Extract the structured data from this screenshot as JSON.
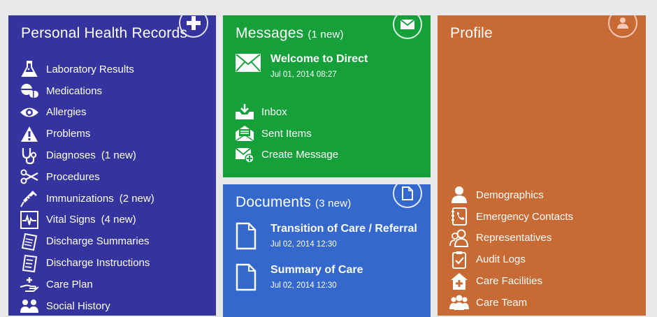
{
  "phr": {
    "title": "Personal Health Records",
    "items": [
      {
        "label": "Laboratory Results",
        "new": ""
      },
      {
        "label": "Medications",
        "new": ""
      },
      {
        "label": "Allergies",
        "new": ""
      },
      {
        "label": "Problems",
        "new": ""
      },
      {
        "label": "Diagnoses",
        "new": "(1 new)"
      },
      {
        "label": "Procedures",
        "new": ""
      },
      {
        "label": "Immunizations",
        "new": "(2 new)"
      },
      {
        "label": "Vital Signs",
        "new": "(4 new)"
      },
      {
        "label": "Discharge Summaries",
        "new": ""
      },
      {
        "label": "Discharge Instructions",
        "new": ""
      },
      {
        "label": "Care Plan",
        "new": ""
      },
      {
        "label": "Social History",
        "new": ""
      }
    ]
  },
  "messages": {
    "title": "Messages",
    "count": "(1 new)",
    "latest": {
      "subject": "Welcome to Direct",
      "date": "Jul 01, 2014 08:27"
    },
    "actions": [
      {
        "label": "Inbox"
      },
      {
        "label": "Sent Items"
      },
      {
        "label": "Create Message"
      }
    ]
  },
  "documents": {
    "title": "Documents",
    "count": "(3 new)",
    "items": [
      {
        "title": "Transition of Care / Referral",
        "date": "Jul 02, 2014 12:30"
      },
      {
        "title": "Summary of Care",
        "date": "Jul 02, 2014 12:30"
      }
    ]
  },
  "profile": {
    "title": "Profile",
    "items": [
      {
        "label": "Demographics"
      },
      {
        "label": "Emergency Contacts"
      },
      {
        "label": "Representatives"
      },
      {
        "label": "Audit Logs"
      },
      {
        "label": "Care Facilities"
      },
      {
        "label": "Care Team"
      }
    ]
  },
  "colors": {
    "phr": "#35339e",
    "messages": "#16a03a",
    "documents": "#3468cc",
    "profile": "#c86a33",
    "background": "#e9e9e9"
  }
}
